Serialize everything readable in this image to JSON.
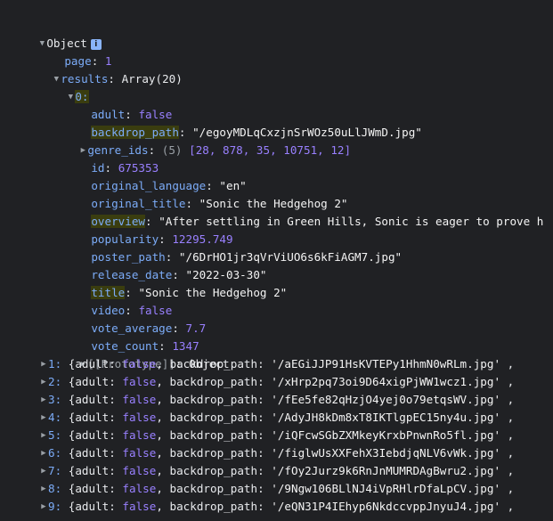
{
  "root": {
    "label": "Object",
    "info": "i"
  },
  "page": {
    "key": "page",
    "value": "1"
  },
  "results": {
    "key": "results",
    "value": "Array(20)"
  },
  "item0": {
    "key": "0:",
    "adult": {
      "key": "adult",
      "value": "false"
    },
    "backdrop_path": {
      "key": "backdrop_path",
      "value": "\"/egoyMDLqCxzjnSrWOz50uLlJWmD.jpg\""
    },
    "genre_ids": {
      "key": "genre_ids",
      "count": "(5)",
      "value": "[28, 878, 35, 10751, 12]"
    },
    "id": {
      "key": "id",
      "value": "675353"
    },
    "original_language": {
      "key": "original_language",
      "value": "\"en\""
    },
    "original_title": {
      "key": "original_title",
      "value": "\"Sonic the Hedgehog 2\""
    },
    "overview": {
      "key": "overview",
      "value": "\"After settling in Green Hills, Sonic is eager to prove h"
    },
    "popularity": {
      "key": "popularity",
      "value": "12295.749"
    },
    "poster_path": {
      "key": "poster_path",
      "value": "\"/6DrHO1jr3qVrViUO6s6kFiAGM7.jpg\""
    },
    "release_date": {
      "key": "release_date",
      "value": "\"2022-03-30\""
    },
    "title": {
      "key": "title",
      "value": "\"Sonic the Hedgehog 2\""
    },
    "video": {
      "key": "video",
      "value": "false"
    },
    "vote_average": {
      "key": "vote_average",
      "value": "7.7"
    },
    "vote_count": {
      "key": "vote_count",
      "value": "1347"
    },
    "prototype": {
      "key": "[[Prototype]]",
      "value": "Object"
    }
  },
  "collapsed_items": [
    {
      "index": "1:",
      "path": "'/aEGiJJP91HsKVTEPy1HhmN0wRLm.jpg'"
    },
    {
      "index": "2:",
      "path": "'/xHrp2pq73oi9D64xigPjWW1wcz1.jpg'"
    },
    {
      "index": "3:",
      "path": "'/fEe5fe82qHzjO4yej0o79etqsWV.jpg'"
    },
    {
      "index": "4:",
      "path": "'/AdyJH8kDm8xT8IKTlgpEC15ny4u.jpg'"
    },
    {
      "index": "5:",
      "path": "'/iQFcwSGbZXMkeyKrxbPnwnRo5fl.jpg'"
    },
    {
      "index": "6:",
      "path": "'/figlwUsXXFehX3IebdjqNLV6vWk.jpg'"
    },
    {
      "index": "7:",
      "path": "'/fOy2Jurz9k6RnJnMUMRDAgBwru2.jpg'"
    },
    {
      "index": "8:",
      "path": "'/9Ngw106BLlNJ4iVpRHlrDfaLpCV.jpg'"
    },
    {
      "index": "9:",
      "path": "'/eQN31P4IEhyp6NkdccvppJnyuJ4.jpg'"
    }
  ],
  "collapsed_labels": {
    "open": "{",
    "adult_key": "adult",
    "adult_val": "false",
    "backdrop_key": "backdrop_path",
    "trail": ","
  }
}
